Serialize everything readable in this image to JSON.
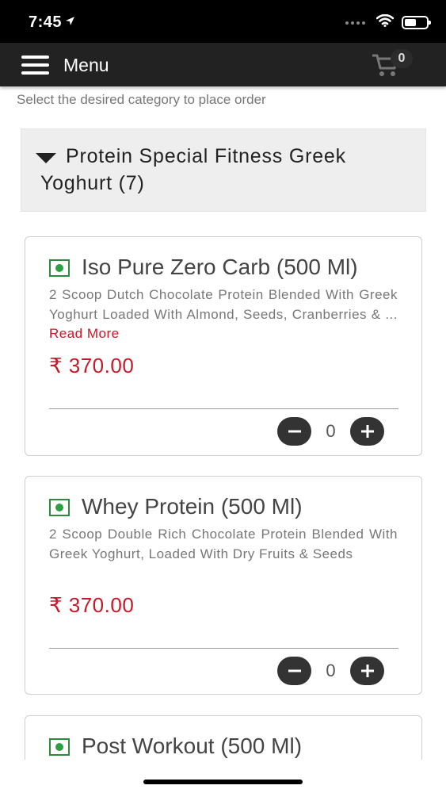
{
  "status_bar": {
    "time": "7:45"
  },
  "header": {
    "menu_label": "Menu",
    "cart_count": "0"
  },
  "instruction": "Select the desired category to place order",
  "category": {
    "title": "Protein Special Fitness Greek Yoghurt (7)"
  },
  "items": [
    {
      "title": "Iso Pure Zero Carb (500 Ml)",
      "description": "2 Scoop Dutch Chocolate Protein Blended With Greek Yoghurt Loaded With Almond, Seeds, Cranberries & ...",
      "read_more": "Read More",
      "price": "₹ 370.00",
      "quantity": "0"
    },
    {
      "title": "Whey Protein (500 Ml)",
      "description": "2 Scoop Double Rich Chocolate Protein Blended With Greek Yoghurt, Loaded With Dry Fruits & Seeds",
      "price": "₹ 370.00",
      "quantity": "0"
    },
    {
      "title": "Post Workout (500 Ml)"
    }
  ],
  "colors": {
    "accent": "#c41a2a",
    "header_bg": "#222222",
    "veg_green": "#2ea043"
  }
}
